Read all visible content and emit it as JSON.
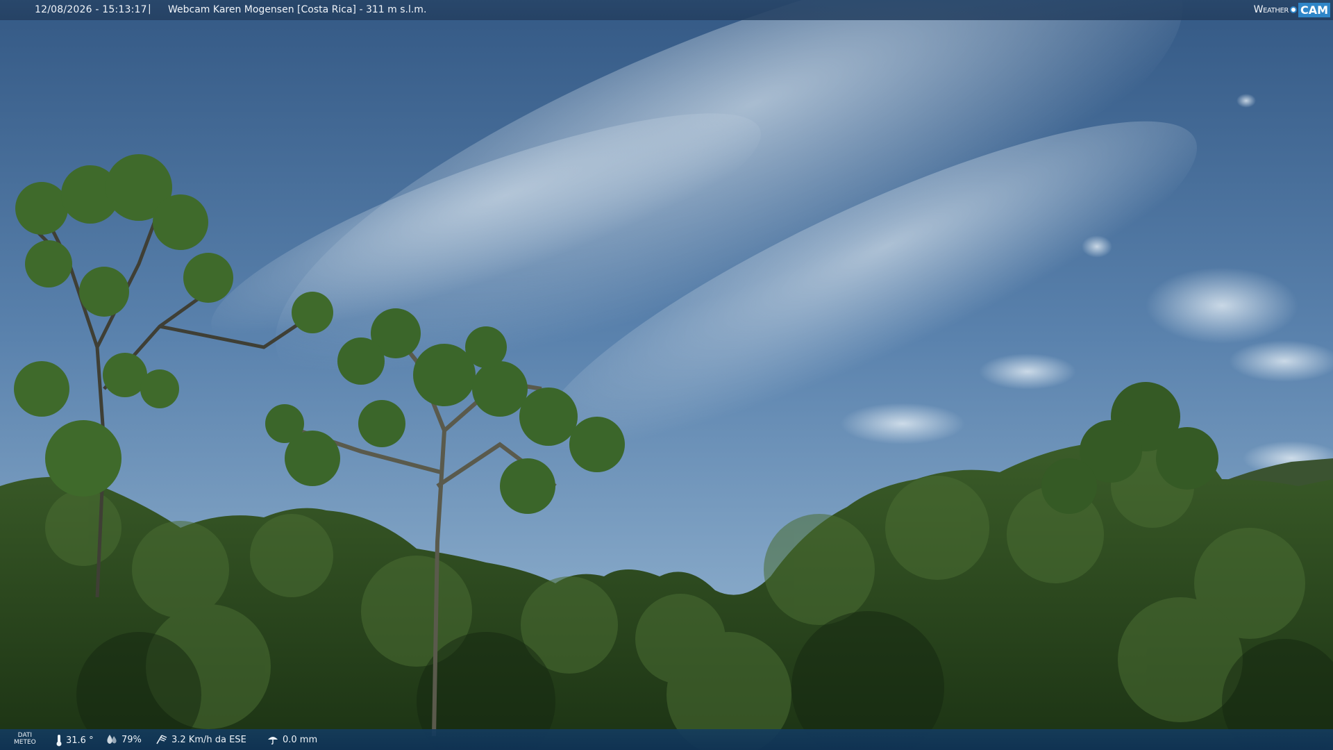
{
  "header": {
    "datetime": "12/08/2026 - 15:13:17",
    "separator": "|",
    "title": "Webcam Karen Mogensen [Costa Rica] - 311 m s.l.m."
  },
  "logo": {
    "word": "Weather",
    "cam": "CAM"
  },
  "weather": {
    "label_line1": "DATI",
    "label_line2": "METEO",
    "temperature": "31.6 °",
    "humidity": "79%",
    "wind": "3.2 Km/h da ESE",
    "rain": "0.0 mm"
  },
  "icons": [
    "thermometer-icon",
    "humidity-drop-icon",
    "wind-icon",
    "rain-icon"
  ],
  "colors": {
    "sky": "#4a77a8",
    "foliage": "#2e4a1d",
    "bar": "#1f4670",
    "logo_accent": "#2f86c8"
  }
}
